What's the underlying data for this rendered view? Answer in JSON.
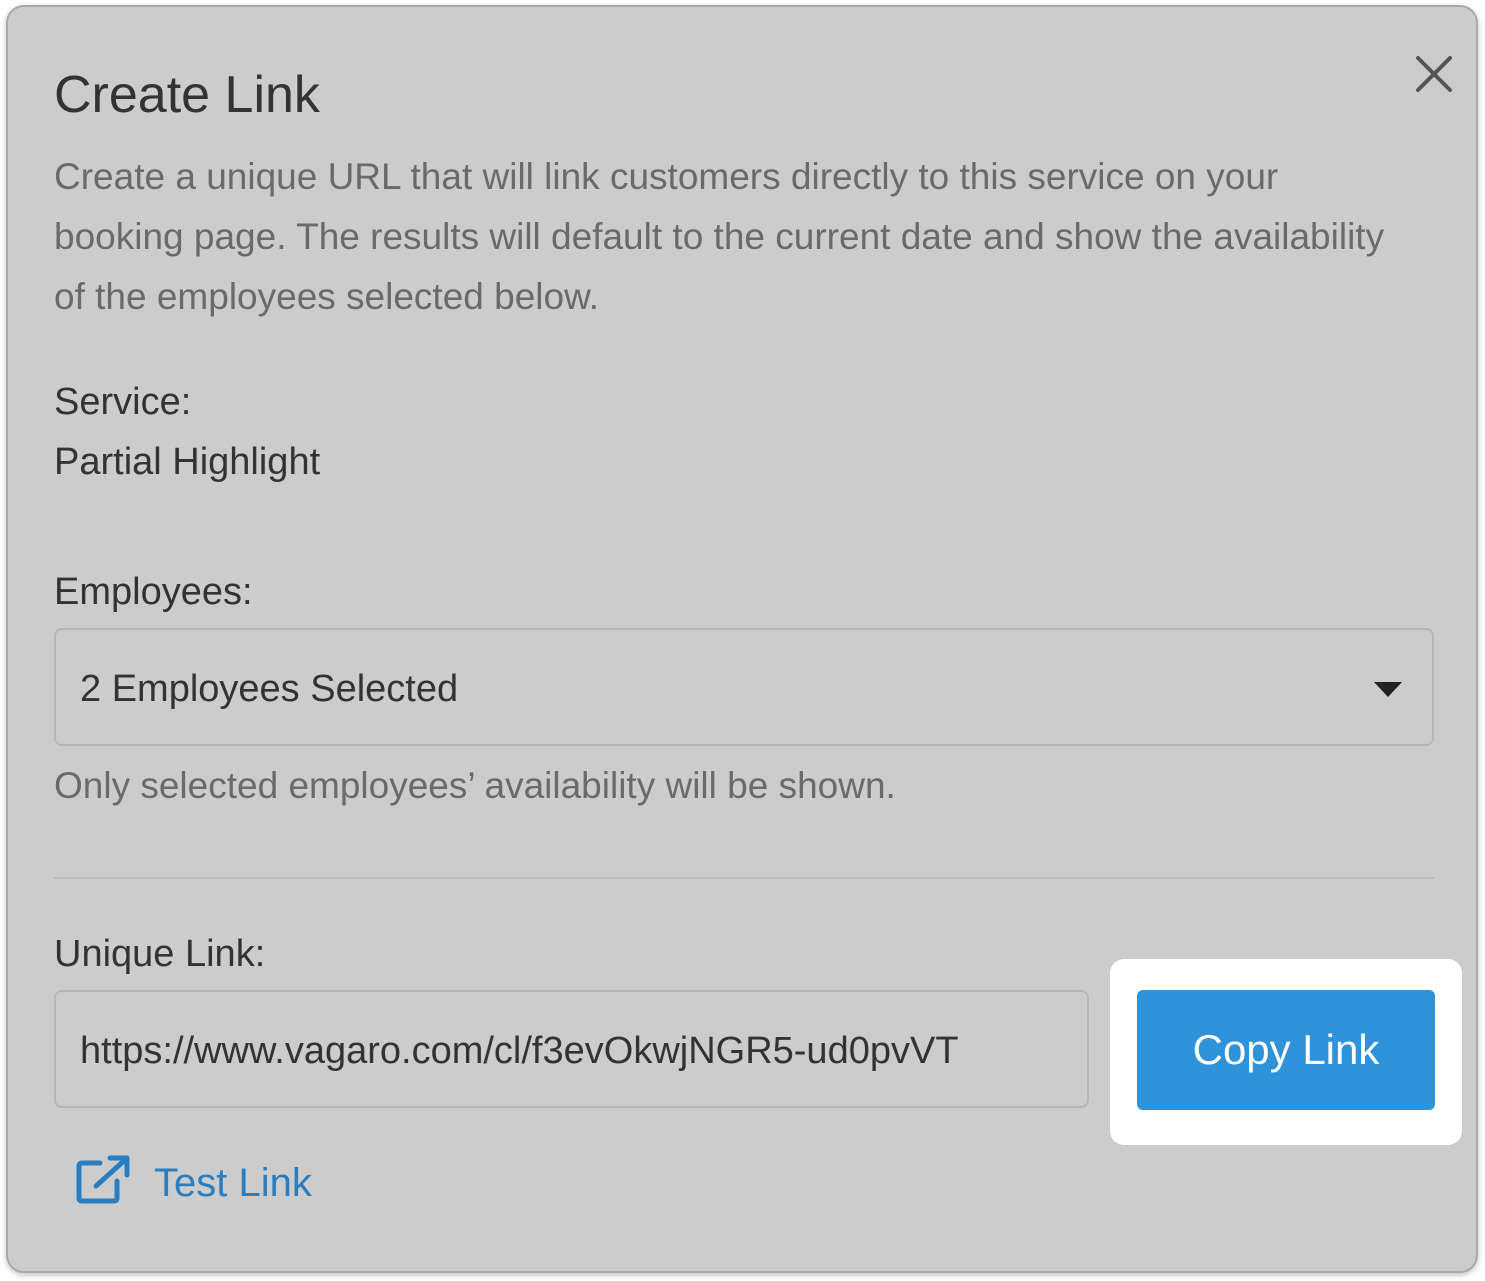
{
  "dialog": {
    "title": "Create Link",
    "description": "Create a unique URL that will link customers directly to this service on your booking page. The results will default to the current date and show the availability of the employees selected below.",
    "close_icon": "close-icon"
  },
  "service": {
    "label": "Service:",
    "value": "Partial Highlight"
  },
  "employees": {
    "label": "Employees:",
    "selected": "2 Employees Selected",
    "helper": "Only selected employees’ availability will be shown.",
    "caret_icon": "caret-down-icon"
  },
  "unique_link": {
    "label": "Unique Link:",
    "value": "https://www.vagaro.com/cl/f3evOkwjNGR5-ud0pvVT",
    "copy_button": "Copy Link",
    "test_link": "Test Link",
    "test_icon": "external-link-icon"
  },
  "colors": {
    "modal_bg": "#cccccc",
    "primary_button": "#2f93da",
    "link": "#2a7ec0",
    "highlight": "#ffffff"
  }
}
